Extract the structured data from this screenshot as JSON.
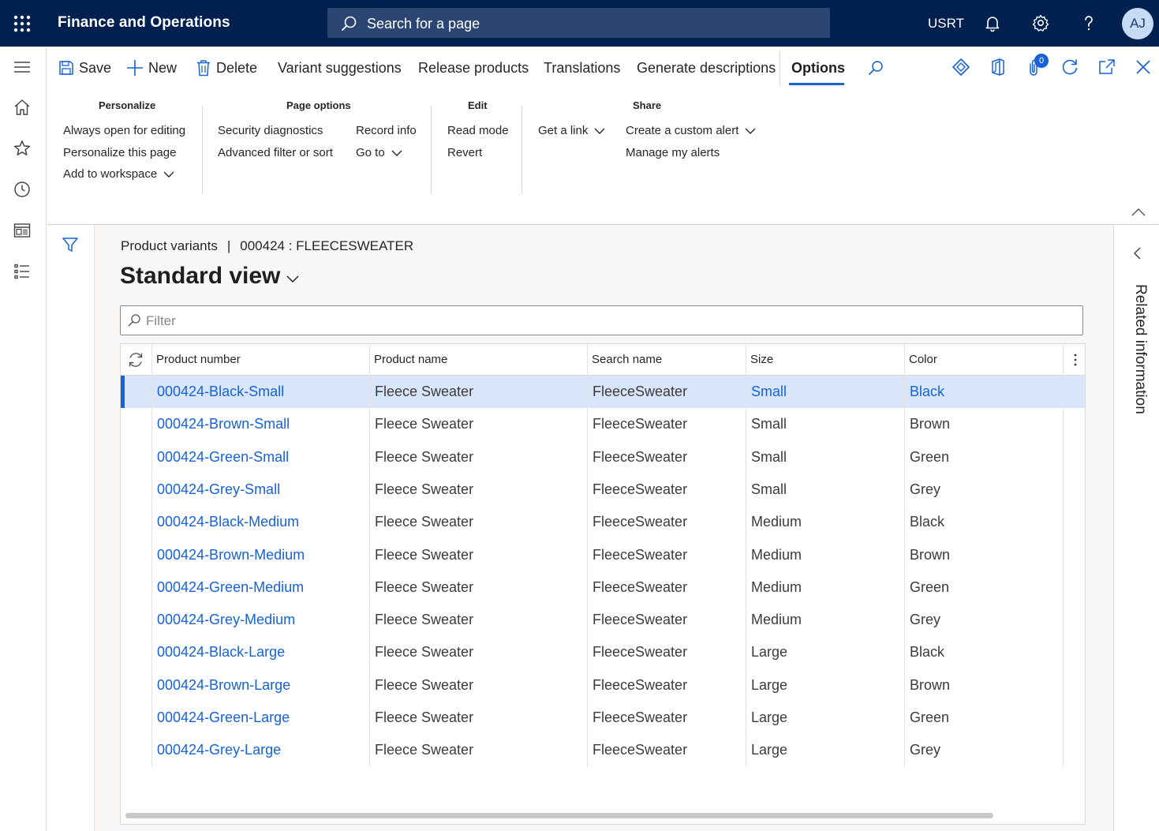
{
  "app": {
    "title": "Finance and Operations",
    "company": "USRT",
    "avatar_initials": "AJ"
  },
  "search": {
    "placeholder": "Search for a page"
  },
  "action_pane": {
    "buttons": {
      "save": "Save",
      "new": "New",
      "delete": "Delete",
      "variant_suggestions": "Variant suggestions",
      "release_products": "Release products",
      "translations": "Translations",
      "generate_descriptions": "Generate descriptions",
      "options": "Options"
    },
    "notification_count": "0",
    "groups": {
      "personalize": {
        "title": "Personalize",
        "items": [
          "Always open for editing",
          "Personalize this page",
          "Add to workspace"
        ]
      },
      "page_options": {
        "title": "Page options",
        "items": [
          "Security diagnostics",
          "Advanced filter or sort",
          "Record info",
          "Go to"
        ]
      },
      "edit": {
        "title": "Edit",
        "items": [
          "Read mode",
          "Revert"
        ]
      },
      "share": {
        "title": "Share",
        "items": [
          "Get a link",
          "Create a custom alert",
          "Manage my alerts"
        ]
      }
    }
  },
  "page": {
    "breadcrumb_left": "Product variants",
    "breadcrumb_sep": "|",
    "breadcrumb_right": "000424 : FLEECESWEATER",
    "view_title": "Standard view",
    "filter_placeholder": "Filter"
  },
  "grid": {
    "columns": [
      "Product number",
      "Product name",
      "Search name",
      "Size",
      "Color"
    ],
    "rows": [
      [
        "000424-Black-Small",
        "Fleece Sweater",
        "FleeceSweater",
        "Small",
        "Black"
      ],
      [
        "000424-Brown-Small",
        "Fleece Sweater",
        "FleeceSweater",
        "Small",
        "Brown"
      ],
      [
        "000424-Green-Small",
        "Fleece Sweater",
        "FleeceSweater",
        "Small",
        "Green"
      ],
      [
        "000424-Grey-Small",
        "Fleece Sweater",
        "FleeceSweater",
        "Small",
        "Grey"
      ],
      [
        "000424-Black-Medium",
        "Fleece Sweater",
        "FleeceSweater",
        "Medium",
        "Black"
      ],
      [
        "000424-Brown-Medium",
        "Fleece Sweater",
        "FleeceSweater",
        "Medium",
        "Brown"
      ],
      [
        "000424-Green-Medium",
        "Fleece Sweater",
        "FleeceSweater",
        "Medium",
        "Green"
      ],
      [
        "000424-Grey-Medium",
        "Fleece Sweater",
        "FleeceSweater",
        "Medium",
        "Grey"
      ],
      [
        "000424-Black-Large",
        "Fleece Sweater",
        "FleeceSweater",
        "Large",
        "Black"
      ],
      [
        "000424-Brown-Large",
        "Fleece Sweater",
        "FleeceSweater",
        "Large",
        "Brown"
      ],
      [
        "000424-Green-Large",
        "Fleece Sweater",
        "FleeceSweater",
        "Large",
        "Green"
      ],
      [
        "000424-Grey-Large",
        "Fleece Sweater",
        "FleeceSweater",
        "Large",
        "Grey"
      ]
    ],
    "selected_row": 0
  },
  "related": {
    "label": "Related information"
  },
  "colors": {
    "topbar": "#002050",
    "accent": "#1662d6",
    "selected_row": "#d9e6fa"
  },
  "icons": {
    "topbar": [
      "app-launcher-icon",
      "search-icon",
      "bell-icon",
      "gear-icon",
      "help-icon"
    ],
    "leftnav": [
      "hamburger-icon",
      "home-icon",
      "star-icon",
      "clock-icon",
      "workspace-icon",
      "list-icon"
    ]
  }
}
